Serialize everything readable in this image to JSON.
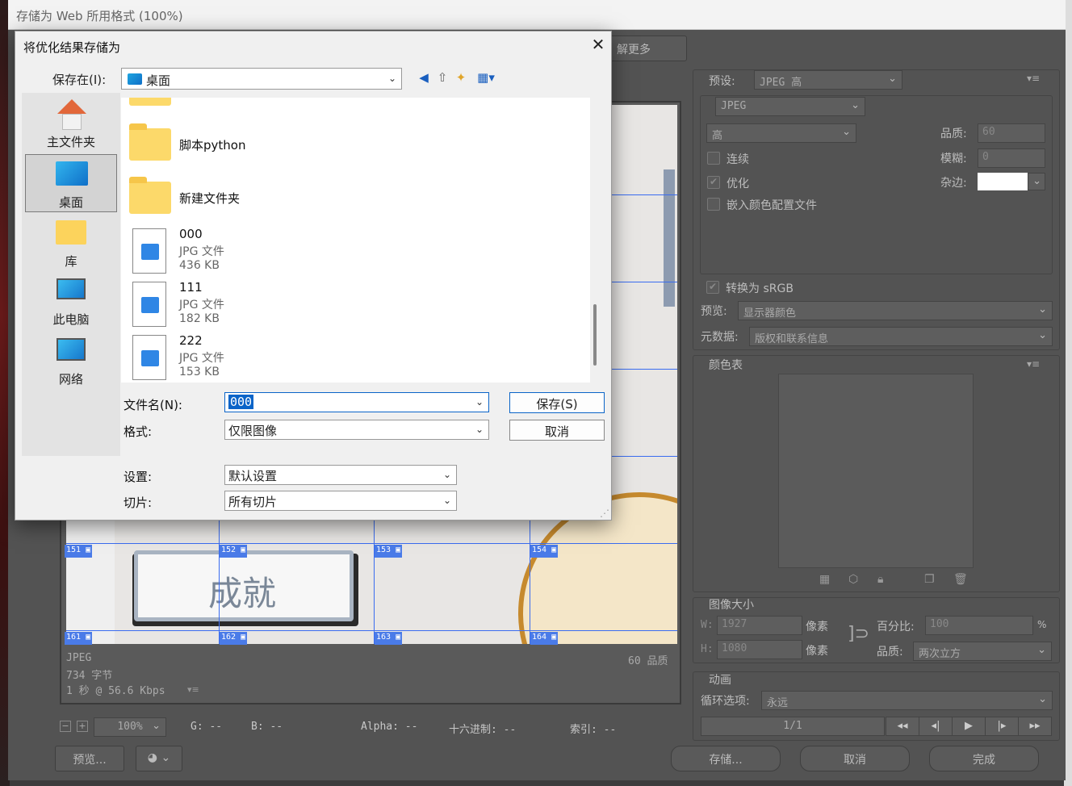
{
  "ps_window": {
    "title": "存储为 Web 所用格式 (100%)",
    "learn_more": "解更多",
    "preset_label": "预设:",
    "preset_value": "JPEG 高",
    "format_value": "JPEG",
    "quality_level": "高",
    "quality_label": "品质:",
    "quality_value": "60",
    "blur_label": "模糊:",
    "blur_value": "0",
    "matte_label": "杂边:",
    "progressive": "连续",
    "optimized": "优化",
    "embed_profile": "嵌入颜色配置文件",
    "convert_srgb": "转换为 sRGB",
    "preview_label": "预览:",
    "preview_value": "显示器颜色",
    "metadata_label": "元数据:",
    "metadata_value": "版权和联系信息",
    "color_table": "颜色表",
    "image_size": "图像大小",
    "w_label": "W:",
    "w_value": "1927",
    "h_label": "H:",
    "h_value": "1080",
    "pixels": "像素",
    "percent_label": "百分比:",
    "percent_value": "100",
    "percent_sign": "%",
    "resample_label": "品质:",
    "resample_value": "两次立方",
    "animation": "动画",
    "loop_label": "循环选项:",
    "loop_value": "永远",
    "frame_counter": "1/1",
    "info_format": "JPEG",
    "info_size": "734 字节",
    "info_time": "1 秒 @ 56.6 Kbps",
    "info_quality": "60 品质",
    "zoom_value": "100%",
    "g_readout": "G: --",
    "b_readout": "B: --",
    "alpha_readout": "Alpha: --",
    "hex_readout": "十六进制: --",
    "index_readout": "索引: --",
    "preview_btn": "预览...",
    "save_btn": "存储...",
    "cancel_btn": "取消",
    "done_btn": "完成",
    "canvas_text": "成就",
    "slices_top": [
      "151",
      "152",
      "153",
      "154"
    ],
    "slices_bottom": [
      "161",
      "162",
      "163",
      "164"
    ]
  },
  "dialog": {
    "title": "将优化结果存储为",
    "save_in_label": "保存在(I):",
    "save_in_value": "桌面",
    "places": [
      {
        "label": "主文件夹",
        "icon": "home-icon"
      },
      {
        "label": "桌面",
        "icon": "desktop-icon"
      },
      {
        "label": "库",
        "icon": "library-icon"
      },
      {
        "label": "此电脑",
        "icon": "computer-icon"
      },
      {
        "label": "网络",
        "icon": "network-icon"
      }
    ],
    "folders": [
      "脚本python",
      "新建文件夹"
    ],
    "files": [
      {
        "name": "000",
        "type": "JPG 文件",
        "size": "436 KB"
      },
      {
        "name": "111",
        "type": "JPG 文件",
        "size": "182 KB"
      },
      {
        "name": "222",
        "type": "JPG 文件",
        "size": "153 KB"
      }
    ],
    "filename_label": "文件名(N):",
    "filename_value": "000",
    "format_label": "格式:",
    "format_value": "仅限图像",
    "settings_label": "设置:",
    "settings_value": "默认设置",
    "slices_label": "切片:",
    "slices_value": "所有切片",
    "save_button": "保存(S)",
    "cancel_button": "取消"
  }
}
